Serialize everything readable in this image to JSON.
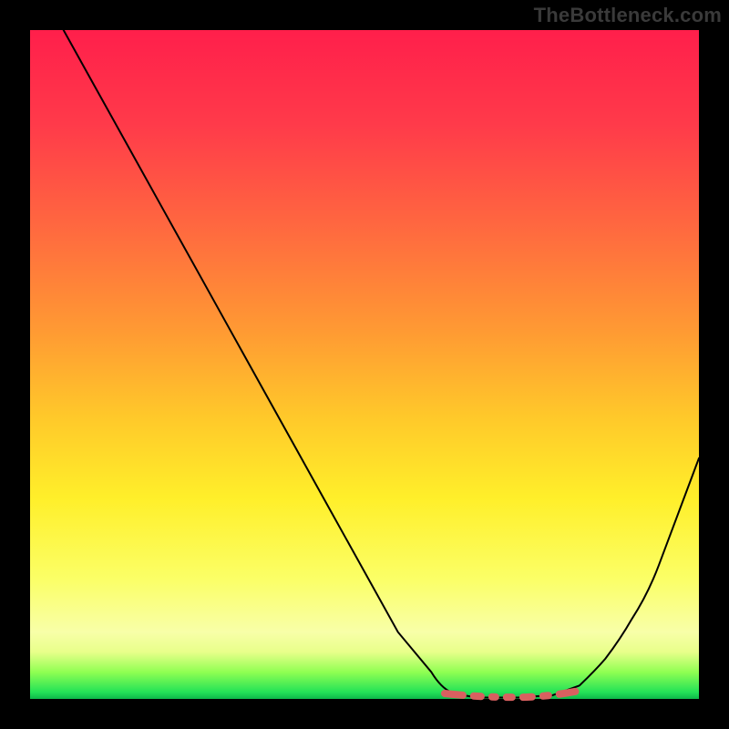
{
  "watermark": "TheBottleneck.com",
  "colors": {
    "page_bg": "#000000",
    "gradient_top": "#ff1f4b",
    "gradient_mid": "#ffef2a",
    "gradient_bottom": "#0db84a",
    "curve": "#000000",
    "valley_marker": "#d86060"
  },
  "chart_data": {
    "type": "line",
    "title": "",
    "xlabel": "",
    "ylabel": "",
    "xlim": [
      0,
      100
    ],
    "ylim": [
      0,
      100
    ],
    "grid": false,
    "legend": false,
    "series": [
      {
        "name": "bottleneck-curve",
        "x": [
          5,
          10,
          15,
          20,
          25,
          30,
          35,
          40,
          45,
          50,
          55,
          60,
          63,
          68,
          73,
          78,
          82,
          86,
          90,
          94,
          100
        ],
        "values": [
          100,
          91,
          82,
          73,
          64,
          55,
          46,
          37,
          28,
          19,
          10,
          4,
          1,
          0.2,
          0.2,
          0.5,
          2,
          6,
          12,
          20,
          36
        ]
      }
    ],
    "annotations": [
      {
        "name": "valley-marker",
        "type": "dashed-segment",
        "x_range": [
          62,
          86
        ],
        "y": 0.6,
        "color": "#d86060"
      }
    ]
  }
}
